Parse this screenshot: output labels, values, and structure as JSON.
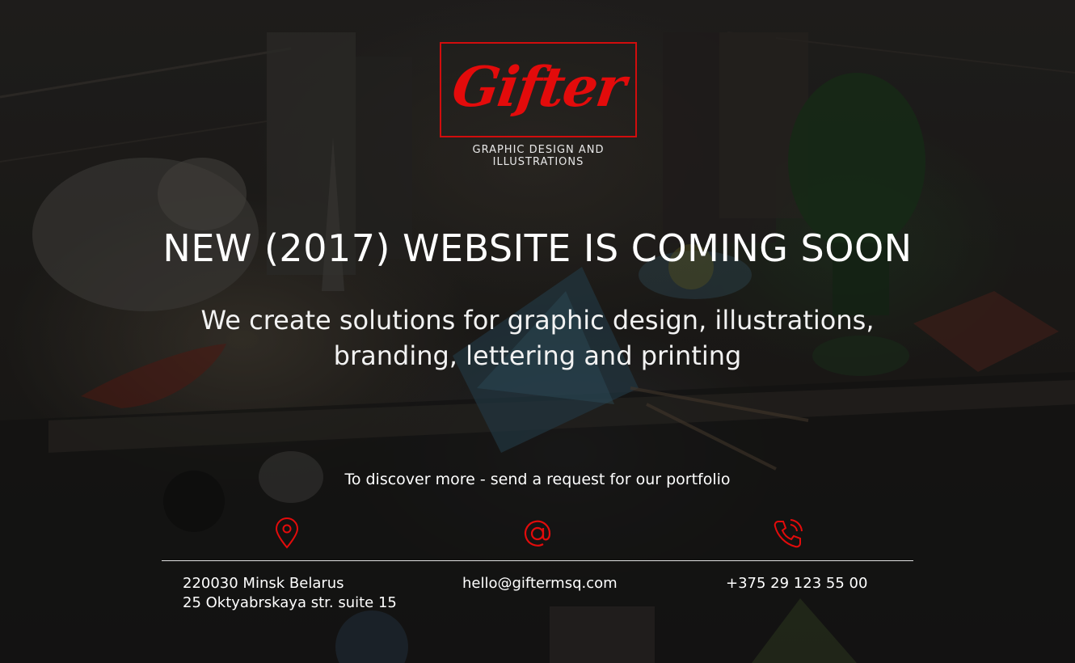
{
  "brand": {
    "logo_text": "Gifter",
    "tagline": "GRAPHIC DESIGN AND ILLUSTRATIONS",
    "accent_color": "#e30b0b"
  },
  "hero": {
    "headline": "NEW (2017) WEBSITE IS COMING SOON",
    "subline": [
      "We create solutions for graphic design, illustrations,",
      "branding, lettering and printing"
    ]
  },
  "contact": {
    "prompt": "To discover more - send a request for our portfolio",
    "address": {
      "icon": "map-pin-icon",
      "lines": [
        "220030 Minsk Belarus",
        "25 Oktyabrskaya str. suite 15"
      ]
    },
    "email": {
      "icon": "at-sign-icon",
      "value": "hello@giftermsq.com"
    },
    "phone": {
      "icon": "phone-ringing-icon",
      "value": "+375 29 123 55 00"
    }
  }
}
